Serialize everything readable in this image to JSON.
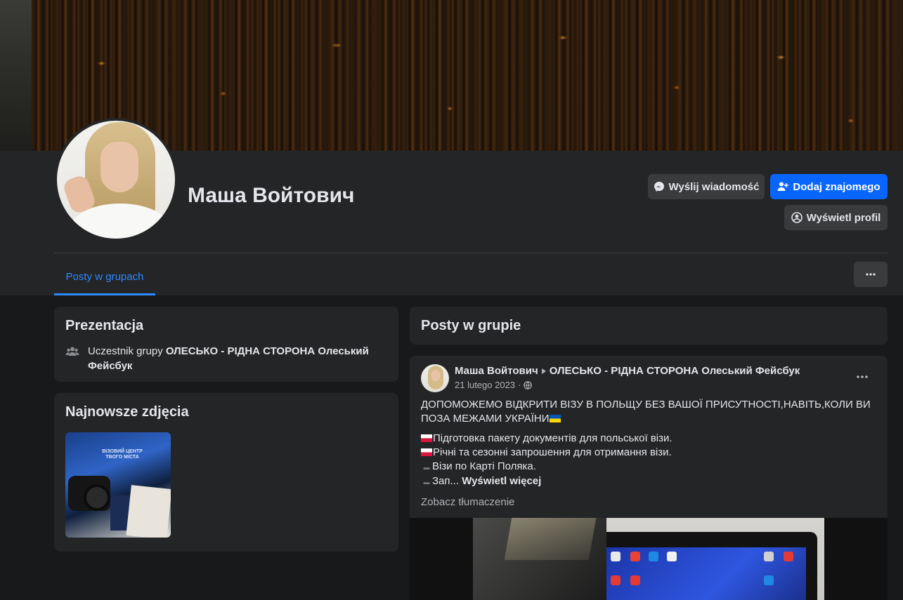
{
  "profile": {
    "name": "Маша Войтович"
  },
  "actions": {
    "message_label": "Wyślij wiadomość",
    "add_friend_label": "Dodaj znajomego",
    "view_profile_label": "Wyświetl profil"
  },
  "tabs": [
    {
      "label": "Posty w grupach",
      "active": true
    }
  ],
  "intro": {
    "title": "Prezentacja",
    "member_prefix": "Uczestnik grupy",
    "group_name": "ОЛЕСЬКО - РІДНА СТОРОНА Олеський Фейсбук"
  },
  "photos": {
    "title": "Najnowsze zdjęcia",
    "thumb_text": "ВІЗОВИЙ ЦЕНТР ТВОГО МІСТА"
  },
  "posts_section": {
    "title": "Posty w grupie"
  },
  "post": {
    "author": "Маша Войтович",
    "group": "ОЛЕСЬКО - РІДНА СТОРОНА Олеський Фейсбук",
    "date": "21 lutego 2023",
    "headline": "ДОПОМОЖЕМО ВІДКРИТИ ВІЗУ В ПОЛЬЩУ БЕЗ ВАШОЇ ПРИСУТНОСТІ,НАВІТЬ,КОЛИ ВИ ПОЗА МЕЖАМИ УКРАЇНИ",
    "lines": [
      "Підготовка пакету документів для польської візи.",
      "Річні та сезонні запрошення для отримання візи.",
      "Візи по Карті Поляка.",
      "Зап..."
    ],
    "see_more": "Wyświetl więcej",
    "translate": "Zobacz tłumaczenie"
  },
  "colors": {
    "accent": "#2d88ff",
    "primary_button": "#0866ff",
    "panel": "#242526",
    "background": "#18191a"
  },
  "icons": {
    "message": "messenger-icon",
    "add_friend": "add-person-icon",
    "view_profile": "user-circle-icon",
    "more": "more-dots-icon",
    "group": "group-icon",
    "visibility": "globe-icon"
  }
}
